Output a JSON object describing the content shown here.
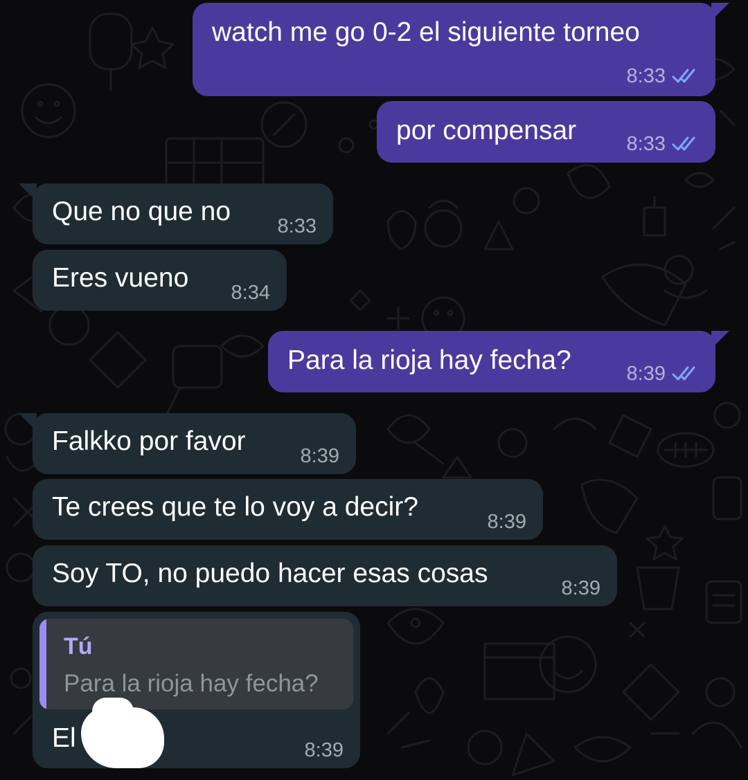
{
  "messages": [
    {
      "direction": "outgoing",
      "text": "watch me go 0-2 el siguiente torneo",
      "time": "8:33",
      "status": "read-double-check-icon"
    },
    {
      "direction": "outgoing",
      "text": "por compensar",
      "time": "8:33",
      "status": "read-double-check-icon"
    },
    {
      "direction": "incoming",
      "text": "Que no que no",
      "time": "8:33"
    },
    {
      "direction": "incoming",
      "text": "Eres vueno",
      "time": "8:34"
    },
    {
      "direction": "outgoing",
      "text": "Para la rioja hay fecha?",
      "time": "8:39",
      "status": "read-double-check-icon"
    },
    {
      "direction": "incoming",
      "text": "Falkko por favor",
      "time": "8:39"
    },
    {
      "direction": "incoming",
      "text": "Te crees que te lo voy a decir?",
      "time": "8:39"
    },
    {
      "direction": "incoming",
      "text": "Soy TO, no puedo hacer esas cosas",
      "time": "8:39"
    },
    {
      "direction": "incoming",
      "reply_to": {
        "author": "Tú",
        "text": "Para la rioja hay fecha?"
      },
      "text": "El",
      "time": "8:39",
      "redacted": true
    }
  ],
  "colors": {
    "background": "#0b0b0d",
    "outgoing_bubble": "#4b3a9e",
    "incoming_bubble": "#202c33",
    "read_ticks": "#7fa8ff",
    "reply_accent": "#9b8cf0"
  }
}
